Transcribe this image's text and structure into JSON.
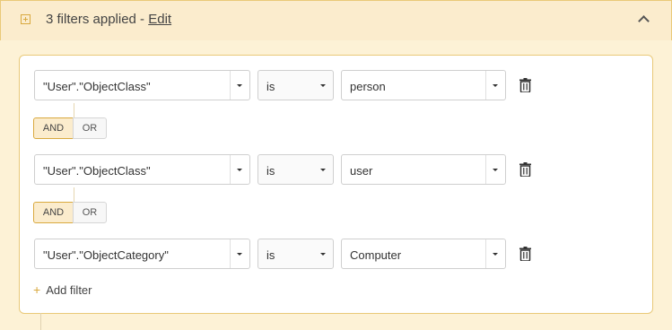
{
  "header": {
    "summary": "3 filters applied - ",
    "edit_label": "Edit"
  },
  "filters": [
    {
      "field": "\"User\".\"ObjectClass\"",
      "operator": "is",
      "value": "person"
    },
    {
      "field": "\"User\".\"ObjectClass\"",
      "operator": "is",
      "value": "user"
    },
    {
      "field": "\"User\".\"ObjectCategory\"",
      "operator": "is",
      "value": "Computer"
    }
  ],
  "logic": [
    {
      "and_label": "AND",
      "or_label": "OR",
      "selected": "AND"
    },
    {
      "and_label": "AND",
      "or_label": "OR",
      "selected": "AND"
    }
  ],
  "add_filter_label": "Add filter",
  "colors": {
    "accent": "#d9a93f",
    "header_bg": "#fbeccd",
    "border": "#e9c978"
  },
  "icons": {
    "expand": "plus-square-icon",
    "collapse": "chevron-up-icon",
    "delete": "trash-icon",
    "dropdown": "caret-down-icon"
  }
}
